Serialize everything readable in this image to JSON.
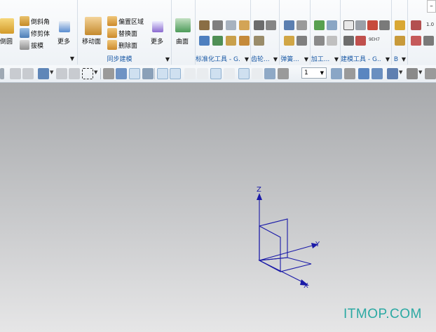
{
  "ribbon": {
    "g1": {
      "big_label": "倒圆",
      "items": [
        "倒斜角",
        "修剪体",
        "拔模"
      ],
      "more": "更多"
    },
    "g2": {
      "big_label": "移动面",
      "items": [
        "偏置区域",
        "替换面",
        "删除面"
      ],
      "more": "更多",
      "label": "同步建模"
    },
    "g3": {
      "big_label": "曲面"
    },
    "g4": {
      "label": "标准化工具 - G..."
    },
    "g5": {
      "label": "齿轮..."
    },
    "g6": {
      "label": "弹簧..."
    },
    "g7": {
      "label": "加工..."
    },
    "g8": {
      "label": "建模工具 - G..."
    },
    "g9": {
      "label": "B"
    },
    "corner_glyph": "1.0",
    "cell_text": "9EH7"
  },
  "toolbar2": {
    "layer_value": "1"
  },
  "viewport": {
    "axes": {
      "z": "Z",
      "y": "Y",
      "x": "X"
    }
  },
  "watermark": "ITMOP.COM",
  "colors": {
    "axis": "#1a1aa8",
    "ribbon_label": "#1b5aa6",
    "watermark": "#2ba9a3"
  }
}
